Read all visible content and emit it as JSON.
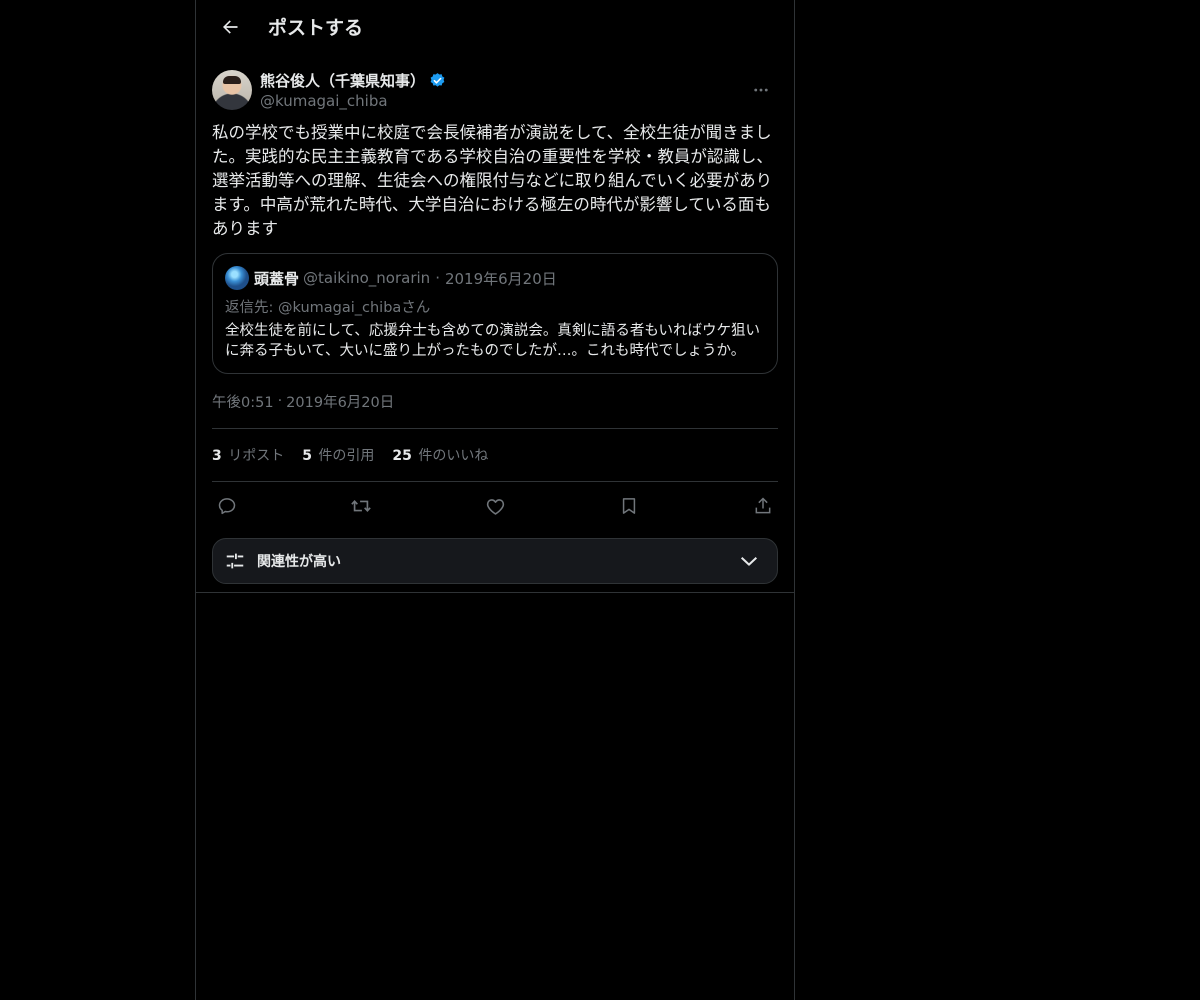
{
  "header": {
    "title": "ポストする"
  },
  "post": {
    "author": {
      "name": "熊谷俊人（千葉県知事）",
      "handle": "@kumagai_chiba"
    },
    "text": "私の学校でも授業中に校庭で会長候補者が演説をして、全校生徒が聞きました。実践的な民主主義教育である学校自治の重要性を学校・教員が認識し、選挙活動等への理解、生徒会への権限付与などに取り組んでいく必要があります。中高が荒れた時代、大学自治における極左の時代が影響している面もあります",
    "quote": {
      "name": "頭蓋骨",
      "handle": "@taikino_norarin",
      "date": "2019年6月20日",
      "reply_to": "返信先: @kumagai_chibaさん",
      "text": "全校生徒を前にして、応援弁士も含めての演説会。真剣に語る者もいればウケ狙いに奔る子もいて、大いに盛り上がったものでしたが…。これも時代でしょうか。"
    },
    "time": "午後0:51",
    "date": "2019年6月20日",
    "stats": {
      "reposts_count": "3",
      "reposts_label": "リポスト",
      "quotes_count": "5",
      "quotes_label": "件の引用",
      "likes_count": "25",
      "likes_label": "件のいいね"
    },
    "separator": "·"
  },
  "actions": [
    "reply-icon",
    "repost-icon",
    "like-icon",
    "bookmark-icon",
    "share-icon"
  ],
  "relevance": {
    "label": "関連性が高い"
  },
  "colors": {
    "background": "#000000",
    "text": "#e7e9ea",
    "muted": "#71767b",
    "border": "#2f3336",
    "verified": "#1d9bf0"
  }
}
